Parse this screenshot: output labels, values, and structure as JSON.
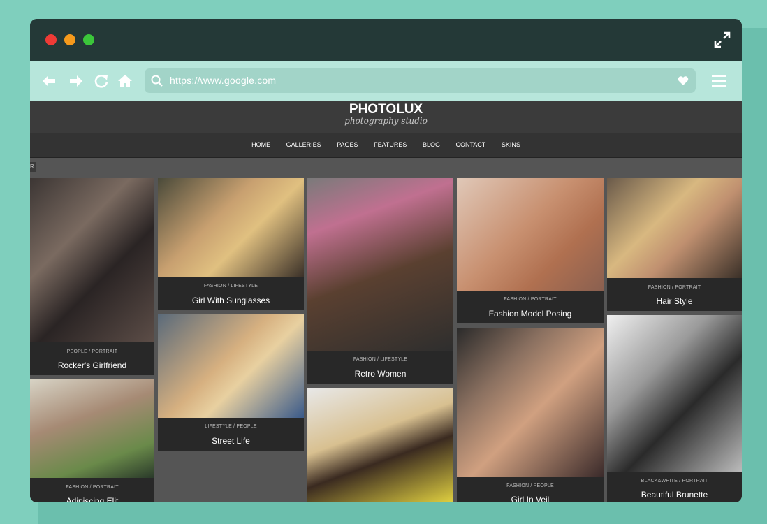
{
  "browser": {
    "url": "https://www.google.com",
    "colors": {
      "titlebar": "#243937",
      "navbar": "#b7e6db",
      "urlbar": "#a2d4c8",
      "background": "#7fcfbd"
    },
    "icons": [
      "back-arrow-icon",
      "forward-arrow-icon",
      "reload-icon",
      "home-icon",
      "search-icon",
      "heart-icon",
      "hamburger-menu-icon",
      "expand-icon"
    ]
  },
  "site": {
    "logo": "PHOTOLUX",
    "tagline": "photography studio",
    "menu": [
      "HOME",
      "GALLERIES",
      "PAGES",
      "FEATURES",
      "BLOG",
      "CONTACT",
      "SKINS"
    ],
    "filter_label": "R"
  },
  "gallery": [
    {
      "category": "PEOPLE / PORTRAIT",
      "title": "Rocker's Girlfriend"
    },
    {
      "category": "FASHION / PORTRAIT",
      "title": "Adipiscing Elit"
    },
    {
      "category": "FASHION / LIFESTYLE",
      "title": "Girl With Sunglasses"
    },
    {
      "category": "LIFESTYLE / PEOPLE",
      "title": "Street Life"
    },
    {
      "category": "FASHION / LIFESTYLE",
      "title": "Retro Women"
    },
    {
      "category": "",
      "title": ""
    },
    {
      "category": "FASHION / PORTRAIT",
      "title": "Fashion Model Posing"
    },
    {
      "category": "FASHION / PEOPLE",
      "title": "Girl In Veil"
    },
    {
      "category": "FASHION / PORTRAIT",
      "title": "Hair Style"
    },
    {
      "category": "BLACK&WHITE / PORTRAIT",
      "title": "Beautiful Brunette"
    }
  ]
}
